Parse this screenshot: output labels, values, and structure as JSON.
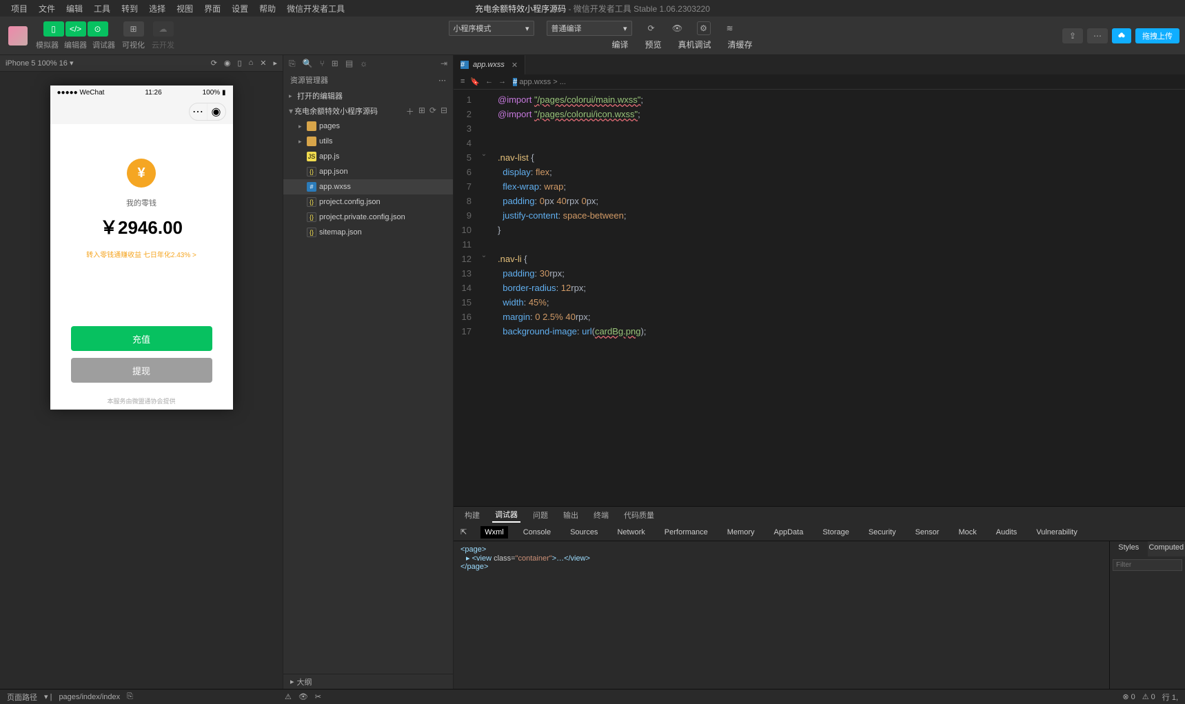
{
  "menu": {
    "items": [
      "项目",
      "文件",
      "编辑",
      "工具",
      "转到",
      "选择",
      "视图",
      "界面",
      "设置",
      "帮助",
      "微信开发者工具"
    ]
  },
  "title": {
    "project": "充电余额特效小程序源码",
    "app": "微信开发者工具 Stable 1.06.2303220"
  },
  "toolbar": {
    "row1": {
      "mode_select": "小程序模式",
      "compile_select": "普通编译"
    },
    "labels": {
      "simulator": "模拟器",
      "editor": "编辑器",
      "debugger": "调试器",
      "visual": "可视化",
      "cloud": "云开发",
      "compile": "编译",
      "preview": "预览",
      "realdbg": "真机调试",
      "clear": "清缓存"
    },
    "upload": "拖拽上传"
  },
  "sim": {
    "device": "iPhone 5 100% 16",
    "arrow": "▾",
    "phone": {
      "carrier": "●●●●● WeChat",
      "time": "11:26",
      "battery": "100%",
      "wallet_label": "我的零钱",
      "balance": "￥2946.00",
      "promo": "转入零钱通赚收益 七日年化2.43% >",
      "btn_topup": "充值",
      "btn_withdraw": "提现",
      "footer": "本服务由微盟通协会提供"
    }
  },
  "explorer": {
    "title": "资源管理器",
    "open_editors": "打开的编辑器",
    "project": "充电余额特效小程序源码",
    "tree": [
      {
        "name": "pages",
        "type": "folder",
        "indent": 1,
        "arrow": "▸"
      },
      {
        "name": "utils",
        "type": "folder",
        "indent": 1,
        "arrow": "▸"
      },
      {
        "name": "app.js",
        "type": "js",
        "indent": 1
      },
      {
        "name": "app.json",
        "type": "json",
        "indent": 1
      },
      {
        "name": "app.wxss",
        "type": "wxss",
        "indent": 1,
        "selected": true
      },
      {
        "name": "project.config.json",
        "type": "json",
        "indent": 1
      },
      {
        "name": "project.private.config.json",
        "type": "json",
        "indent": 1
      },
      {
        "name": "sitemap.json",
        "type": "json",
        "indent": 1
      }
    ],
    "outline": "大纲"
  },
  "editor": {
    "tab": "app.wxss",
    "breadcrumb": "app.wxss > ...",
    "lines": [
      {
        "n": 1,
        "seg": [
          [
            "kw",
            "@import "
          ],
          [
            "err",
            "\"/pages/colorui/main.wxss\""
          ],
          [
            "punc",
            ";"
          ]
        ]
      },
      {
        "n": 2,
        "seg": [
          [
            "kw",
            "@import "
          ],
          [
            "err",
            "\"/pages/colorui/icon.wxss\""
          ],
          [
            "punc",
            ";"
          ]
        ]
      },
      {
        "n": 3,
        "seg": []
      },
      {
        "n": 4,
        "seg": []
      },
      {
        "n": 5,
        "fold": "⌄",
        "seg": [
          [
            "sel",
            ".nav-list "
          ],
          [
            "punc",
            "{"
          ]
        ]
      },
      {
        "n": 6,
        "seg": [
          [
            "",
            "  "
          ],
          [
            "prop",
            "display"
          ],
          [
            "punc",
            ": "
          ],
          [
            "num",
            "flex"
          ],
          [
            "punc",
            ";"
          ]
        ]
      },
      {
        "n": 7,
        "seg": [
          [
            "",
            "  "
          ],
          [
            "prop",
            "flex-wrap"
          ],
          [
            "punc",
            ": "
          ],
          [
            "num",
            "wrap"
          ],
          [
            "punc",
            ";"
          ]
        ]
      },
      {
        "n": 8,
        "seg": [
          [
            "",
            "  "
          ],
          [
            "prop",
            "padding"
          ],
          [
            "punc",
            ": "
          ],
          [
            "num",
            "0"
          ],
          [
            "punc",
            "px "
          ],
          [
            "num",
            "40"
          ],
          [
            "punc",
            "rpx "
          ],
          [
            "num",
            "0"
          ],
          [
            "punc",
            "px;"
          ]
        ]
      },
      {
        "n": 9,
        "seg": [
          [
            "",
            "  "
          ],
          [
            "prop",
            "justify-content"
          ],
          [
            "punc",
            ": "
          ],
          [
            "num",
            "space-between"
          ],
          [
            "punc",
            ";"
          ]
        ]
      },
      {
        "n": 10,
        "seg": [
          [
            "punc",
            "}"
          ]
        ]
      },
      {
        "n": 11,
        "seg": []
      },
      {
        "n": 12,
        "fold": "⌄",
        "seg": [
          [
            "sel",
            ".nav-li "
          ],
          [
            "punc",
            "{"
          ]
        ]
      },
      {
        "n": 13,
        "seg": [
          [
            "",
            "  "
          ],
          [
            "prop",
            "padding"
          ],
          [
            "punc",
            ": "
          ],
          [
            "num",
            "30"
          ],
          [
            "punc",
            "rpx;"
          ]
        ]
      },
      {
        "n": 14,
        "seg": [
          [
            "",
            "  "
          ],
          [
            "prop",
            "border-radius"
          ],
          [
            "punc",
            ": "
          ],
          [
            "num",
            "12"
          ],
          [
            "punc",
            "rpx;"
          ]
        ]
      },
      {
        "n": 15,
        "seg": [
          [
            "",
            "  "
          ],
          [
            "prop",
            "width"
          ],
          [
            "punc",
            ": "
          ],
          [
            "num",
            "45%"
          ],
          [
            "punc",
            ";"
          ]
        ]
      },
      {
        "n": 16,
        "seg": [
          [
            "",
            "  "
          ],
          [
            "prop",
            "margin"
          ],
          [
            "punc",
            ": "
          ],
          [
            "num",
            "0"
          ],
          [
            "punc",
            " "
          ],
          [
            "num",
            "2.5%"
          ],
          [
            "punc",
            " "
          ],
          [
            "num",
            "40"
          ],
          [
            "punc",
            "rpx;"
          ]
        ]
      },
      {
        "n": 17,
        "seg": [
          [
            "",
            "  "
          ],
          [
            "prop",
            "background-image"
          ],
          [
            "punc",
            ": "
          ],
          [
            "fn",
            "url"
          ],
          [
            "punc",
            "("
          ],
          [
            "err",
            "cardBg.png"
          ],
          [
            "punc",
            ");"
          ]
        ]
      }
    ]
  },
  "debugger": {
    "tabs": [
      "构建",
      "调试器",
      "问题",
      "输出",
      "终端",
      "代码质量"
    ],
    "active_tab": "调试器",
    "devtabs": [
      "Wxml",
      "Console",
      "Sources",
      "Network",
      "Performance",
      "Memory",
      "AppData",
      "Storage",
      "Security",
      "Sensor",
      "Mock",
      "Audits",
      "Vulnerability"
    ],
    "active_dev": "Wxml",
    "wxml": {
      "l1": "<page>",
      "l2a": "▸ <view ",
      "l2b": "class=",
      "l2c": "\"container\"",
      "l2d": ">…</view>",
      "l3": "</page>"
    },
    "styles": {
      "tab_styles": "Styles",
      "tab_computed": "Computed",
      "filter": "Filter"
    }
  },
  "status": {
    "path_label": "页面路径",
    "path": "pages/index/index",
    "line": "行 1,"
  }
}
